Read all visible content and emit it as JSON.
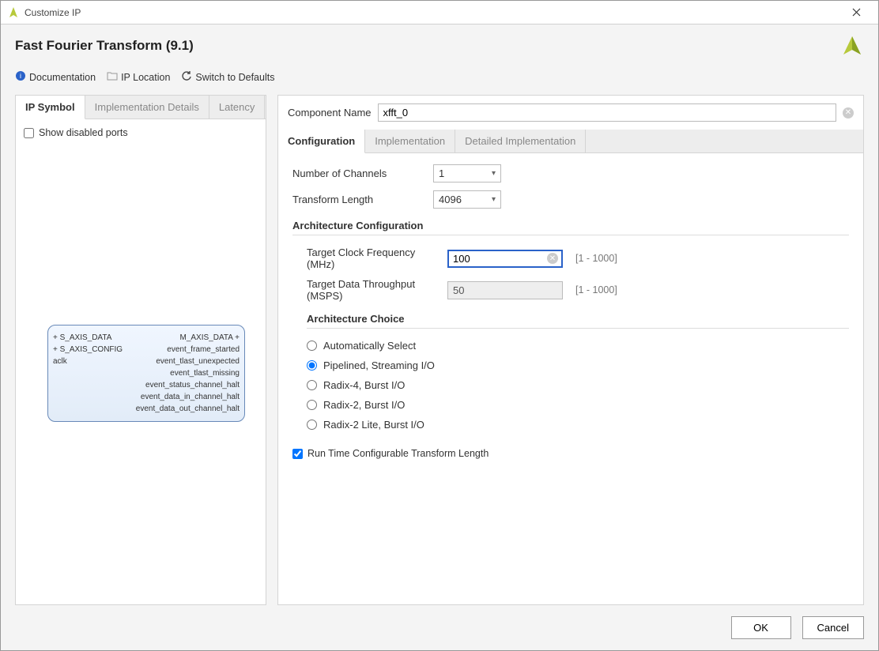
{
  "window": {
    "title": "Customize IP"
  },
  "header": {
    "ip_title": "Fast Fourier Transform (9.1)"
  },
  "toolbar": {
    "documentation": "Documentation",
    "ip_location": "IP Location",
    "switch_defaults": "Switch to Defaults"
  },
  "left": {
    "tabs": {
      "ip_symbol": "IP Symbol",
      "impl_details": "Implementation Details",
      "latency": "Latency"
    },
    "show_disabled_label": "Show disabled ports",
    "show_disabled_checked": false,
    "block": {
      "left_ports": [
        "+ S_AXIS_DATA",
        "+ S_AXIS_CONFIG",
        "aclk"
      ],
      "right_ports": [
        "M_AXIS_DATA +",
        "event_frame_started",
        "event_tlast_unexpected",
        "event_tlast_missing",
        "event_status_channel_halt",
        "event_data_in_channel_halt",
        "event_data_out_channel_halt"
      ]
    }
  },
  "right": {
    "component_name_label": "Component Name",
    "component_name_value": "xfft_0",
    "tabs": {
      "configuration": "Configuration",
      "implementation": "Implementation",
      "detailed_impl": "Detailed Implementation"
    },
    "config": {
      "num_channels_label": "Number of Channels",
      "num_channels_value": "1",
      "transform_length_label": "Transform Length",
      "transform_length_value": "4096",
      "arch_config_hdr": "Architecture Configuration",
      "target_clk_label": "Target Clock Frequency (MHz)",
      "target_clk_value": "100",
      "target_clk_hint": "[1 - 1000]",
      "target_tp_label": "Target Data Throughput (MSPS)",
      "target_tp_value": "50",
      "target_tp_hint": "[1 - 1000]",
      "arch_choice_hdr": "Architecture Choice",
      "arch_options": [
        "Automatically Select",
        "Pipelined, Streaming I/O",
        "Radix-4, Burst I/O",
        "Radix-2, Burst I/O",
        "Radix-2 Lite, Burst I/O"
      ],
      "arch_selected_index": 1,
      "runtime_label": "Run Time Configurable Transform Length",
      "runtime_checked": true
    }
  },
  "footer": {
    "ok": "OK",
    "cancel": "Cancel"
  }
}
